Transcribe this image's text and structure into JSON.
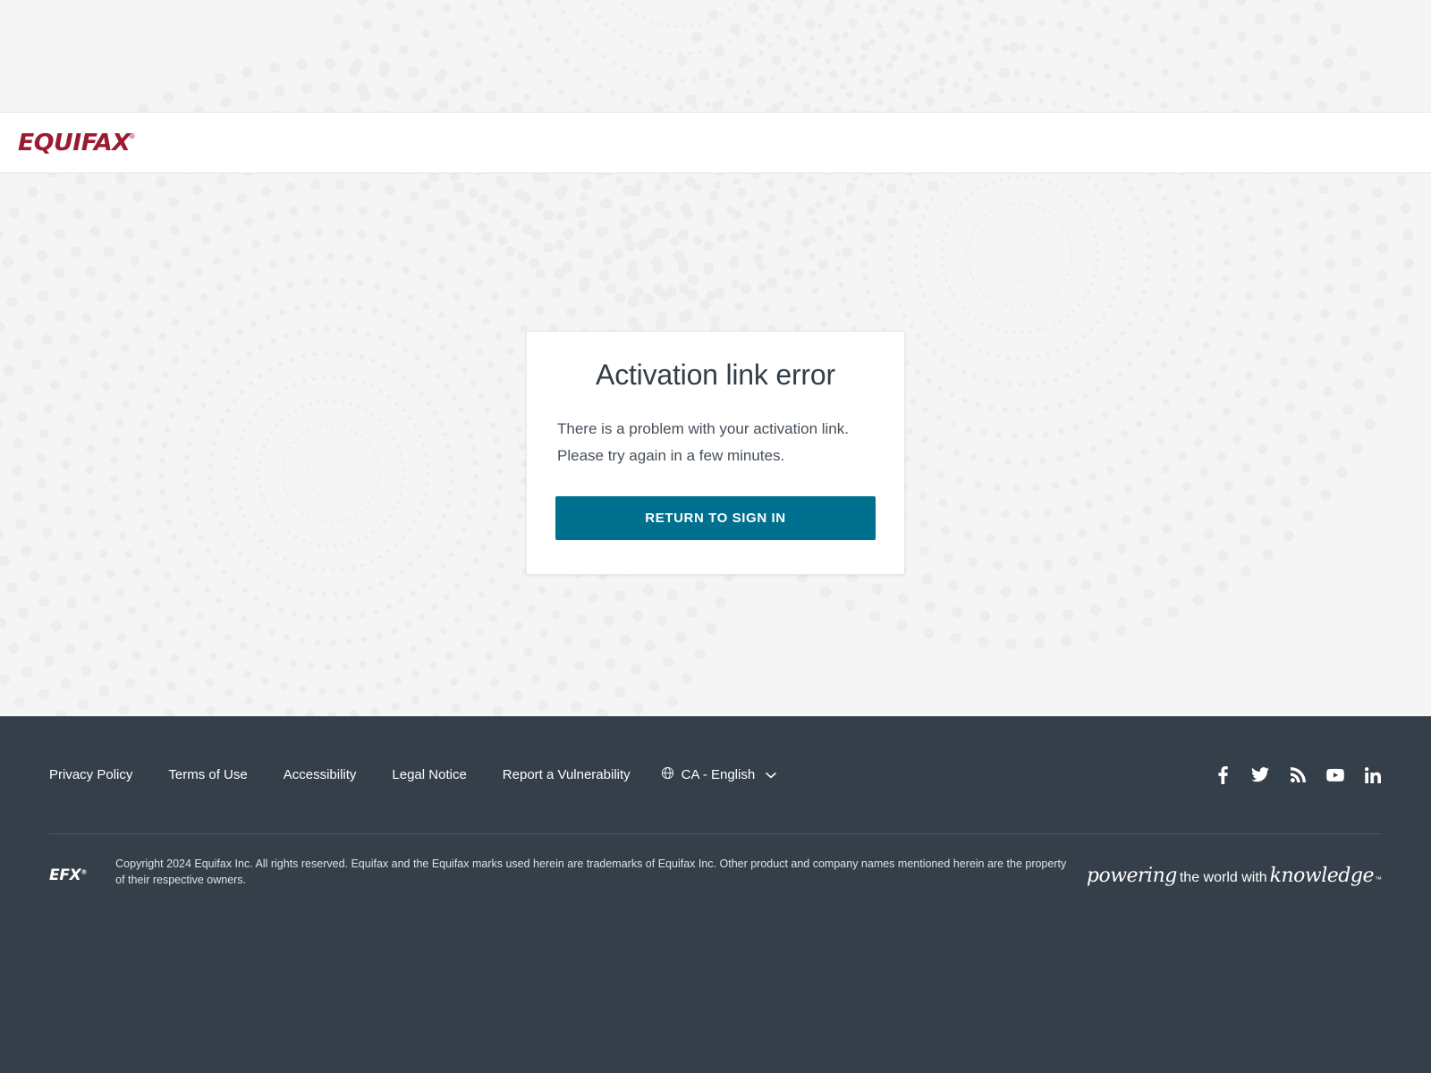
{
  "brand": {
    "logo_text": "EQUIFAX",
    "logo_trademark": "®",
    "logo_color": "#9b1b30"
  },
  "card": {
    "title": "Activation link error",
    "message_line1": "There is a problem with your activation link.",
    "message_line2": "Please try again in a few minutes.",
    "button_label": "RETURN TO SIGN IN",
    "button_color": "#00708f"
  },
  "footer": {
    "background_color": "#343f4a",
    "links": [
      {
        "label": "Privacy Policy",
        "name": "privacy-policy"
      },
      {
        "label": "Terms of Use",
        "name": "terms-of-use"
      },
      {
        "label": "Accessibility",
        "name": "accessibility"
      },
      {
        "label": "Legal Notice",
        "name": "legal-notice"
      },
      {
        "label": "Report a Vulnerability",
        "name": "report-a-vulnerability"
      }
    ],
    "language_selector": {
      "value": "CA - English",
      "globe_icon": "globe-icon",
      "chevron_icon": "chevron-down-icon"
    },
    "social_icons": [
      {
        "name": "facebook-icon",
        "label": "Facebook"
      },
      {
        "name": "twitter-icon",
        "label": "Twitter"
      },
      {
        "name": "rss-icon",
        "label": "RSS"
      },
      {
        "name": "youtube-icon",
        "label": "YouTube"
      },
      {
        "name": "linkedin-icon",
        "label": "LinkedIn"
      }
    ],
    "efx_logo": "EFX",
    "efx_trademark": "®",
    "copyright": "Copyright 2024 Equifax Inc. All rights reserved. Equifax and the Equifax marks used herein are trademarks of Equifax Inc. Other product and company names mentioned herein are the property of their respective owners.",
    "tagline": {
      "word1": "powering",
      "word2": "the world with",
      "word3": "knowledge",
      "trademark": "™"
    }
  }
}
